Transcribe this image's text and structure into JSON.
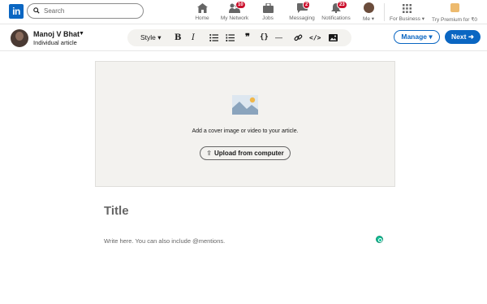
{
  "nav": {
    "logo_text": "in",
    "search_placeholder": "Search",
    "items": [
      {
        "label": "Home",
        "icon": "home-icon"
      },
      {
        "label": "My Network",
        "icon": "network-icon",
        "badge": "10"
      },
      {
        "label": "Jobs",
        "icon": "briefcase-icon"
      },
      {
        "label": "Messaging",
        "icon": "messaging-icon",
        "badge": "2"
      },
      {
        "label": "Notifications",
        "icon": "bell-icon",
        "badge": "23"
      },
      {
        "label": "Me ▾",
        "icon": "avatar"
      },
      {
        "label": "For Business ▾",
        "icon": "grid-icon"
      },
      {
        "label": "Try Premium for ₹0",
        "icon": "premium-icon"
      }
    ]
  },
  "editor": {
    "author_name": "Manoj V Bhat",
    "author_caret": "▼",
    "author_subtitle": "Individual article",
    "toolbar": {
      "style_label": "Style ▾",
      "bold_label": "B",
      "italic_label": "I",
      "quote_label": "❞",
      "code_braces_label": "{}",
      "divider_label": "—",
      "code_label": "</>"
    },
    "manage_label": "Manage ▾",
    "next_label": "Next ➜"
  },
  "cover": {
    "prompt_text": "Add a cover image or video to your article.",
    "upload_label": "Upload from computer",
    "upload_icon": "⇪"
  },
  "article": {
    "title_placeholder": "Title",
    "body_placeholder": "Write here. You can also include @mentions."
  },
  "colors": {
    "brand": "#0a66c2",
    "badge": "#cb112d",
    "cover_bg": "#f3f2ef",
    "grammarly": "#15c39a"
  }
}
